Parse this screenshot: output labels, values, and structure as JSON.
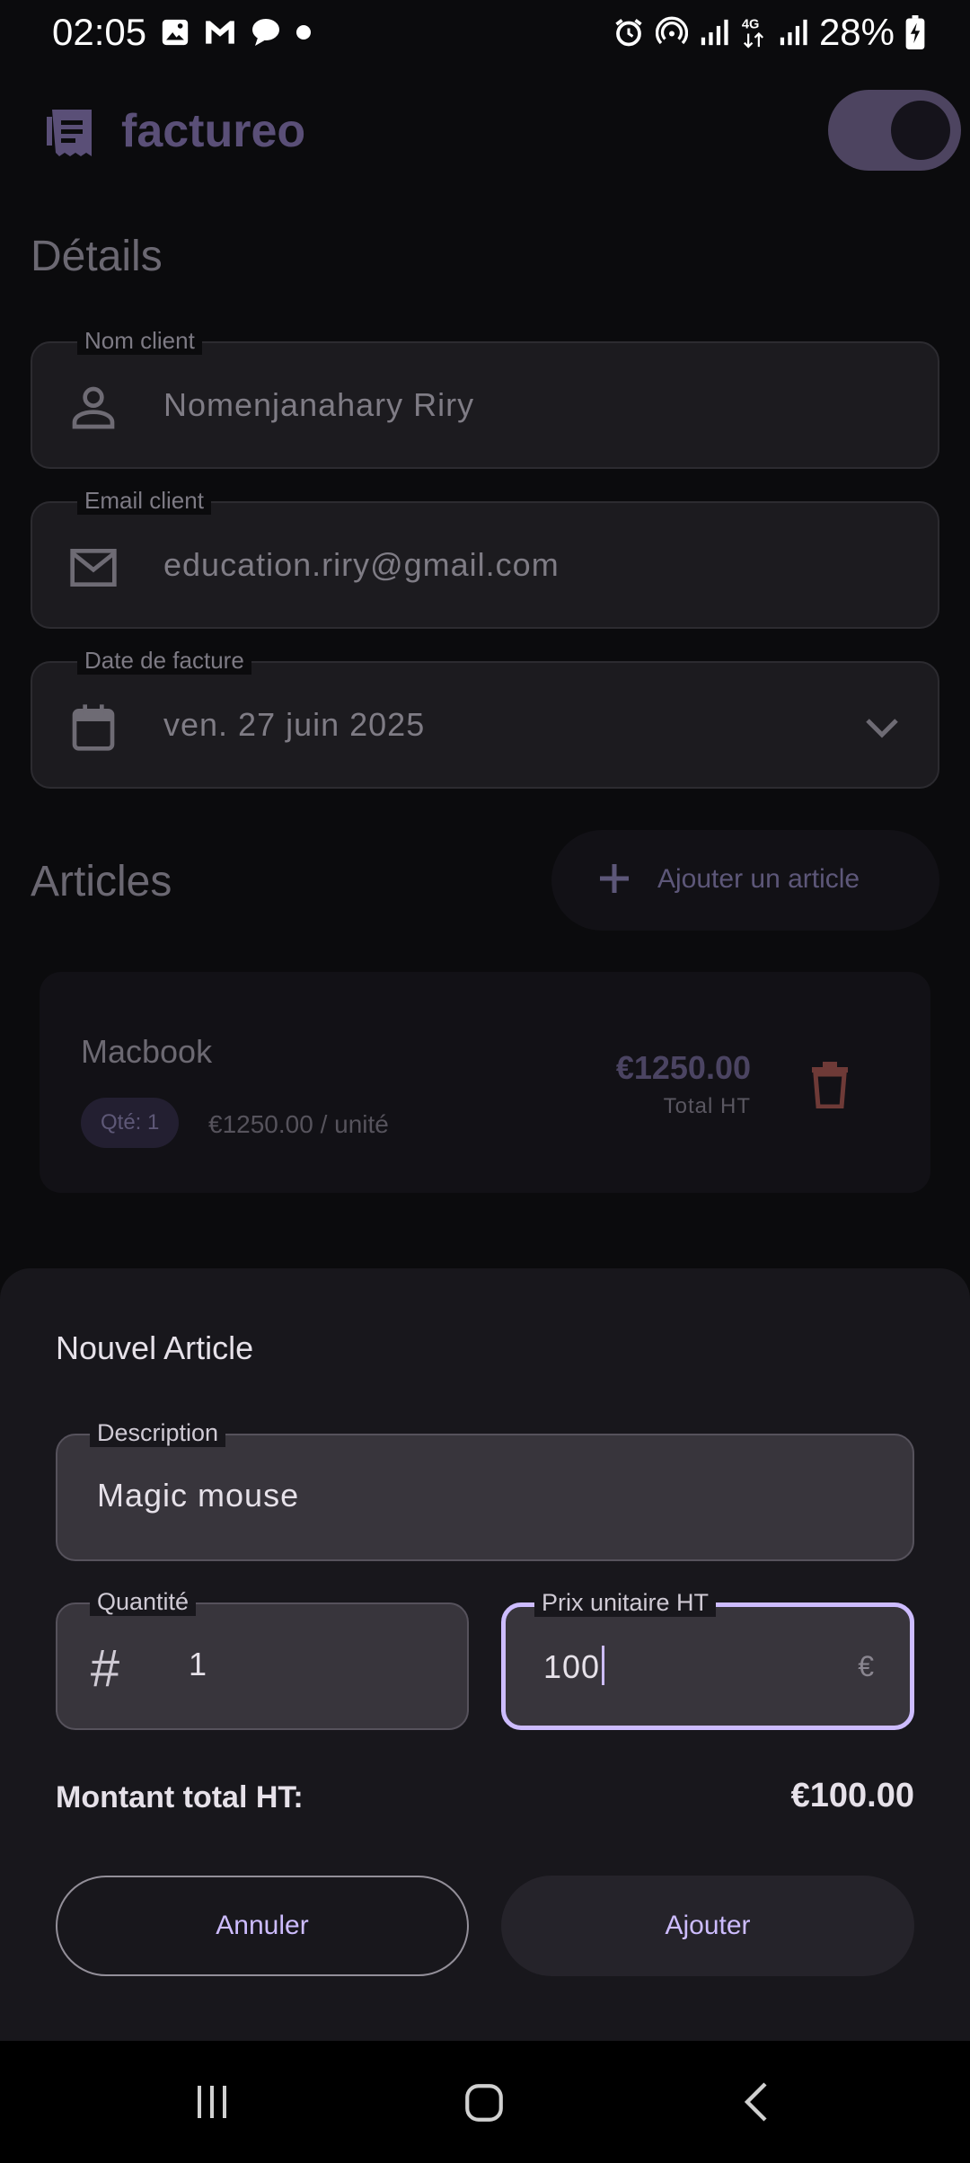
{
  "status_bar": {
    "time": "02:05",
    "battery": "28%",
    "icons": [
      "gallery-icon",
      "gmail-icon",
      "chat-icon",
      "dot-icon",
      "alarm-icon",
      "hotspot-icon",
      "signal-icon",
      "4g-icon",
      "signal-icon",
      "battery-charging-icon"
    ]
  },
  "app_bar": {
    "brand": "factureo",
    "logo_icon": "receipt-icon",
    "theme_toggle_on": true
  },
  "details": {
    "title": "Détails",
    "client_name": {
      "label": "Nom client",
      "value": "Nomenjanahary Riry",
      "icon": "person-icon"
    },
    "client_email": {
      "label": "Email client",
      "value": "education.riry@gmail.com",
      "icon": "mail-icon"
    },
    "invoice_date": {
      "label": "Date de facture",
      "value": "ven. 27 juin 2025",
      "icon": "calendar-icon"
    }
  },
  "articles": {
    "title": "Articles",
    "add_label": "Ajouter un article",
    "items": [
      {
        "name": "Macbook",
        "qty": "Qté: 1",
        "unit_price": "€1250.00 / unité",
        "total": "€1250.00",
        "total_label": "Total HT"
      }
    ]
  },
  "sheet": {
    "title": "Nouvel Article",
    "description": {
      "label": "Description",
      "value": "Magic mouse"
    },
    "quantity": {
      "label": "Quantité",
      "value": "1"
    },
    "unit_price": {
      "label": "Prix unitaire HT",
      "value": "100",
      "suffix": "€"
    },
    "total_label": "Montant total HT:",
    "total_value": "€100.00",
    "cancel_label": "Annuler",
    "add_label": "Ajouter"
  },
  "colors": {
    "accent": "#cdbcff",
    "background": "#0b0b0d",
    "sheet": "#18171c",
    "delete": "#6e3a37"
  }
}
